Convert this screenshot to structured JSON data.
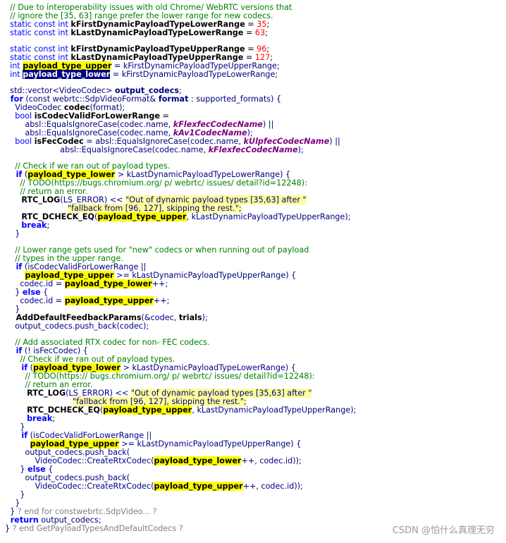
{
  "lines": [
    [
      [
        "cm",
        "  // Due to interoperability issues with old Chrome/ WebRTC versions that"
      ]
    ],
    [
      [
        "cm",
        "  // ignore the [35, 63] range prefer the lower range for new codecs."
      ]
    ],
    [
      [
        "kw",
        "  static const int "
      ],
      [
        "pk",
        "kFirstDynamicPayloadTypeLowerRange"
      ],
      [
        "pl",
        " = "
      ],
      [
        "nb",
        "35"
      ],
      [
        "pl",
        ";"
      ]
    ],
    [
      [
        "kw",
        "  static const int "
      ],
      [
        "pk",
        "kLastDynamicPayloadTypeLowerRange"
      ],
      [
        "pl",
        " = "
      ],
      [
        "nb",
        "63"
      ],
      [
        "pl",
        ";"
      ]
    ],
    [],
    [
      [
        "kw",
        "  static const int "
      ],
      [
        "pk",
        "kFirstDynamicPayloadTypeUpperRange"
      ],
      [
        "pl",
        " = "
      ],
      [
        "nb",
        "96"
      ],
      [
        "pl",
        ";"
      ]
    ],
    [
      [
        "kw",
        "  static const int "
      ],
      [
        "pk",
        "kLastDynamicPayloadTypeUpperRange"
      ],
      [
        "pl",
        " = "
      ],
      [
        "nb",
        "127"
      ],
      [
        "pl",
        ";"
      ]
    ],
    [
      [
        "kw",
        "  int "
      ],
      [
        "hl",
        "payload_type_upper"
      ],
      [
        "id",
        " = kFirstDynamicPayloadTypeUpperRange;"
      ]
    ],
    [
      [
        "kw",
        "  int "
      ],
      [
        "hd",
        "payload_type_lower"
      ],
      [
        "id",
        " = kFirstDynamicPayloadTypeLowerRange;"
      ]
    ],
    [],
    [
      [
        "id",
        "  std::vector<VideoCodec> "
      ],
      [
        "ib",
        "output_codecs"
      ],
      [
        "pl",
        ";"
      ]
    ],
    [
      [
        "kwb",
        "  for"
      ],
      [
        "id",
        " (const webrtc::SdpVideoFormat& "
      ],
      [
        "ib",
        "format"
      ],
      [
        "id",
        " : supported_formats) {"
      ]
    ],
    [
      [
        "id",
        "    VideoCodec "
      ],
      [
        "pk",
        "codec"
      ],
      [
        "id",
        "(format);"
      ]
    ],
    [
      [
        "kw",
        "    bool "
      ],
      [
        "pk",
        "isCodecValidForLowerRange"
      ],
      [
        "pl",
        " ="
      ]
    ],
    [
      [
        "id",
        "        absl::EqualsIgnoreCase(codec.name, "
      ],
      [
        "mg",
        "kFlexfecCodecName"
      ],
      [
        "id",
        ") ||"
      ]
    ],
    [
      [
        "id",
        "        absl::EqualsIgnoreCase(codec.name, "
      ],
      [
        "mg",
        "kAv1CodecName"
      ],
      [
        "id",
        ");"
      ]
    ],
    [
      [
        "kw",
        "    bool "
      ],
      [
        "pk",
        "isFecCodec"
      ],
      [
        "id",
        " = absl::EqualsIgnoreCase(codec.name, "
      ],
      [
        "mg",
        "kUlpfecCodecName"
      ],
      [
        "id",
        ") ||"
      ]
    ],
    [
      [
        "id",
        "                      absl::EqualsIgnoreCase(codec.name, "
      ],
      [
        "mg",
        "kFlexfecCodecName"
      ],
      [
        "id",
        ");"
      ]
    ],
    [],
    [
      [
        "cm",
        "    // Check if we ran out of payload types."
      ]
    ],
    [
      [
        "kwb",
        "    if"
      ],
      [
        "id",
        " ("
      ],
      [
        "hl",
        "payload_type_lower"
      ],
      [
        "id",
        " > kLastDynamicPayloadTypeLowerRange) {"
      ]
    ],
    [
      [
        "cm",
        "      // TODO(https://bugs.chromium.org/ p/ webrtc/ issues/ detail?id=12248):"
      ]
    ],
    [
      [
        "cm",
        "      // return an error."
      ]
    ],
    [
      [
        "pk",
        "      RTC_LOG"
      ],
      [
        "id",
        "(LS_ERROR) << "
      ],
      [
        "sh",
        "\"Out of dynamic payload types [35,63] after \""
      ]
    ],
    [
      [
        "id",
        "                         "
      ],
      [
        "sh",
        "\"fallback from [96, 127], skipping the rest.\";"
      ]
    ],
    [
      [
        "pk",
        "      RTC_DCHECK_EQ"
      ],
      [
        "id",
        "("
      ],
      [
        "hl",
        "payload_type_upper"
      ],
      [
        "id",
        ", kLastDynamicPayloadTypeUpperRange);"
      ]
    ],
    [
      [
        "kwb",
        "      break"
      ],
      [
        "pl",
        ";"
      ]
    ],
    [
      [
        "id",
        "    }"
      ]
    ],
    [],
    [
      [
        "cm",
        "    // Lower range gets used for \"new\" codecs or when running out of payload"
      ]
    ],
    [
      [
        "cm",
        "    // types in the upper range."
      ]
    ],
    [
      [
        "kwb",
        "    if"
      ],
      [
        "id",
        " (isCodecValidForLowerRange ||"
      ]
    ],
    [
      [
        "id",
        "        "
      ],
      [
        "hl",
        "payload_type_upper"
      ],
      [
        "id",
        " >= kLastDynamicPayloadTypeUpperRange) {"
      ]
    ],
    [
      [
        "id",
        "      codec.id = "
      ],
      [
        "hl",
        "payload_type_lower"
      ],
      [
        "id",
        "++;"
      ]
    ],
    [
      [
        "id",
        "    } "
      ],
      [
        "kwb",
        "else"
      ],
      [
        "id",
        " {"
      ]
    ],
    [
      [
        "id",
        "      codec.id = "
      ],
      [
        "hl",
        "payload_type_upper"
      ],
      [
        "id",
        "++;"
      ]
    ],
    [
      [
        "id",
        "    }"
      ]
    ],
    [
      [
        "pk",
        "    AddDefaultFeedbackParams"
      ],
      [
        "id",
        "(&codec, "
      ],
      [
        "pk",
        "trials"
      ],
      [
        "id",
        ");"
      ]
    ],
    [
      [
        "id",
        "    output_codecs.push_back(codec);"
      ]
    ],
    [],
    [
      [
        "cm",
        "    // Add associated RTX codec for non- FEC codecs."
      ]
    ],
    [
      [
        "kwb",
        "    if"
      ],
      [
        "id",
        " (! isFecCodec) {"
      ]
    ],
    [
      [
        "cm",
        "      // Check if we ran out of payload types."
      ]
    ],
    [
      [
        "kwb",
        "      if"
      ],
      [
        "id",
        " ("
      ],
      [
        "hl",
        "payload_type_lower"
      ],
      [
        "id",
        " > kLastDynamicPayloadTypeLowerRange) {"
      ]
    ],
    [
      [
        "cm",
        "        // TODO(https:// bugs.chromium.org/ p/ webrtc/ issues/ detail?id=12248):"
      ]
    ],
    [
      [
        "cm",
        "        // return an error."
      ]
    ],
    [
      [
        "pk",
        "        RTC_LOG"
      ],
      [
        "id",
        "(LS_ERROR) << "
      ],
      [
        "sh",
        "\"Out of dynamic payload types [35,63] after \""
      ]
    ],
    [
      [
        "id",
        "                           "
      ],
      [
        "sh",
        "\"fallback from [96, 127], skipping the rest.\";"
      ]
    ],
    [
      [
        "pk",
        "        RTC_DCHECK_EQ"
      ],
      [
        "id",
        "("
      ],
      [
        "hl",
        "payload_type_upper"
      ],
      [
        "id",
        ", kLastDynamicPayloadTypeUpperRange);"
      ]
    ],
    [
      [
        "kwb",
        "        break"
      ],
      [
        "pl",
        ";"
      ]
    ],
    [
      [
        "id",
        "      }"
      ]
    ],
    [
      [
        "kwb",
        "      if"
      ],
      [
        "id",
        " (isCodecValidForLowerRange ||"
      ]
    ],
    [
      [
        "id",
        "          "
      ],
      [
        "hl",
        "payload_type_upper"
      ],
      [
        "id",
        " >= kLastDynamicPayloadTypeUpperRange) {"
      ]
    ],
    [
      [
        "id",
        "        output_codecs.push_back("
      ]
    ],
    [
      [
        "id",
        "            VideoCodec::CreateRtxCodec("
      ],
      [
        "hl",
        "payload_type_lower"
      ],
      [
        "id",
        "++, codec.id));"
      ]
    ],
    [
      [
        "id",
        "      } "
      ],
      [
        "kwb",
        "else"
      ],
      [
        "id",
        " {"
      ]
    ],
    [
      [
        "id",
        "        output_codecs.push_back("
      ]
    ],
    [
      [
        "id",
        "            VideoCodec::CreateRtxCodec("
      ],
      [
        "hl",
        "payload_type_upper"
      ],
      [
        "id",
        "++, codec.id));"
      ]
    ],
    [
      [
        "id",
        "      }"
      ]
    ],
    [
      [
        "id",
        "    }"
      ]
    ],
    [
      [
        "id",
        "  } "
      ],
      [
        "cl",
        "? end for constwebrtc.SdpVideo... ?"
      ]
    ],
    [
      [
        "kwb",
        "  return"
      ],
      [
        "id",
        " output_codecs;"
      ]
    ],
    [
      [
        "id",
        "} "
      ],
      [
        "cl",
        "? end GetPayloadTypesAndDefaultCodecs ?"
      ]
    ]
  ],
  "watermark": "CSDN @怕什么真理无穷"
}
